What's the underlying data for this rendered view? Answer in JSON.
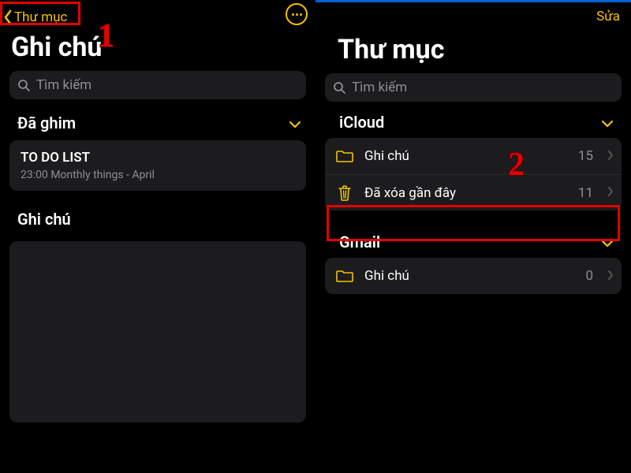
{
  "left": {
    "back_label": "Thư mục",
    "page_title": "Ghi chú",
    "search_placeholder": "Tìm kiếm",
    "pinned_header": "Đã ghim",
    "pinned_note": {
      "title": "TO DO LIST",
      "subtitle": "23:00  Monthly things - April"
    },
    "notes_header": "Ghi chú"
  },
  "right": {
    "edit_label": "Sửa",
    "page_title": "Thư mục",
    "search_placeholder": "Tìm kiếm",
    "sections": {
      "icloud": {
        "title": "iCloud",
        "items": [
          {
            "icon": "folder",
            "label": "Ghi chú",
            "count": "15"
          },
          {
            "icon": "trash",
            "label": "Đã xóa gần đây",
            "count": "11"
          }
        ]
      },
      "gmail": {
        "title": "Gmail",
        "items": [
          {
            "icon": "folder",
            "label": "Ghi chú",
            "count": "0"
          }
        ]
      }
    }
  },
  "annotations": {
    "num1": "1",
    "num2": "2"
  }
}
